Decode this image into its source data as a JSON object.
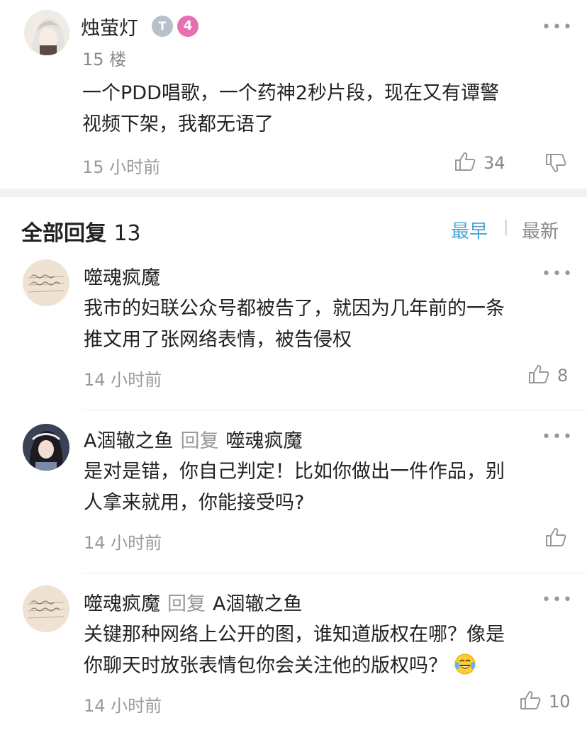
{
  "op": {
    "username": "烛萤灯",
    "badge_t": "T",
    "badge_level": "4",
    "floor": "15 楼",
    "text_line1": "一个PDD唱歌，一个药神2秒片段，现在又有谭警",
    "text_line2": "视频下架，我都无语了",
    "time": "15 小时前",
    "likes": "34",
    "more": "•••"
  },
  "replies_header": {
    "title": "全部回复",
    "count": "13",
    "sort_earliest": "最早",
    "sort_separator": "|",
    "sort_newest": "最新"
  },
  "replies": [
    {
      "username": "噬魂疯魔",
      "text_line1": "我市的妇联公众号都被告了，就因为几年前的一条",
      "text_line2": "推文用了张网络表情，被告侵权",
      "time": "14 小时前",
      "likes": "8",
      "more": "•••"
    },
    {
      "username": "A涸辙之鱼",
      "reply_word": "回复",
      "reply_to": "噬魂疯魔",
      "text_line1": "是对是错，你自己判定！比如你做出一件作品，别",
      "text_line2": "人拿来就用，你能接受吗?",
      "time": "14 小时前",
      "more": "•••"
    },
    {
      "username": "噬魂疯魔",
      "reply_word": "回复",
      "reply_to": "A涸辙之鱼",
      "text_line1": "关键那种网络上公开的图，谁知道版权在哪？像是",
      "text_line2": "你聊天时放张表情包你会关注他的版权吗？",
      "time": "14 小时前",
      "likes": "10",
      "more": "•••"
    }
  ],
  "colors": {
    "accent_blue": "#4aa3d6",
    "level_badge": "#e86fb0",
    "badge_gray": "#b8c0cc",
    "gray_text": "#9a9a9a"
  },
  "icons": {
    "thumbs_up": "thumbs-up-icon",
    "thumbs_down": "thumbs-down-icon",
    "more": "more-dots-icon",
    "emoji": "laughing-tears-emoji-icon"
  }
}
